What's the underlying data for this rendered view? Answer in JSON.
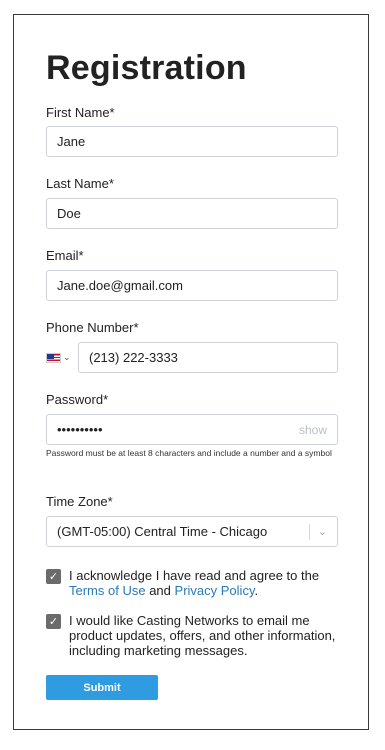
{
  "form": {
    "title": "Registration",
    "first_name": {
      "label": "First Name*",
      "value": "Jane"
    },
    "last_name": {
      "label": "Last Name*",
      "value": "Doe"
    },
    "email": {
      "label": "Email*",
      "value": "Jane.doe@gmail.com"
    },
    "phone": {
      "label": "Phone Number*",
      "country_icon": "us-flag-icon",
      "value": "(213) 222-3333"
    },
    "password": {
      "label": "Password*",
      "value": "••••••••••",
      "toggle": "show",
      "hint": "Password must be at least 8 characters and include a number and a symbol"
    },
    "time_zone": {
      "label": "Time Zone*",
      "value": "(GMT-05:00) Central Time - Chicago"
    },
    "terms": {
      "checked": true,
      "prefix": "I acknowledge I have read and agree to the",
      "terms_link": "Terms of Use",
      "and": "and",
      "privacy_link": "Privacy Policy",
      "suffix": "."
    },
    "marketing": {
      "checked": true,
      "text": "I would like Casting Networks to email me product updates, offers, and other information, including marketing messages."
    },
    "submit_label": "Submit"
  },
  "colors": {
    "accent": "#2f9be0",
    "link": "#2a7ab8",
    "checkbox": "#6b6b6b"
  }
}
